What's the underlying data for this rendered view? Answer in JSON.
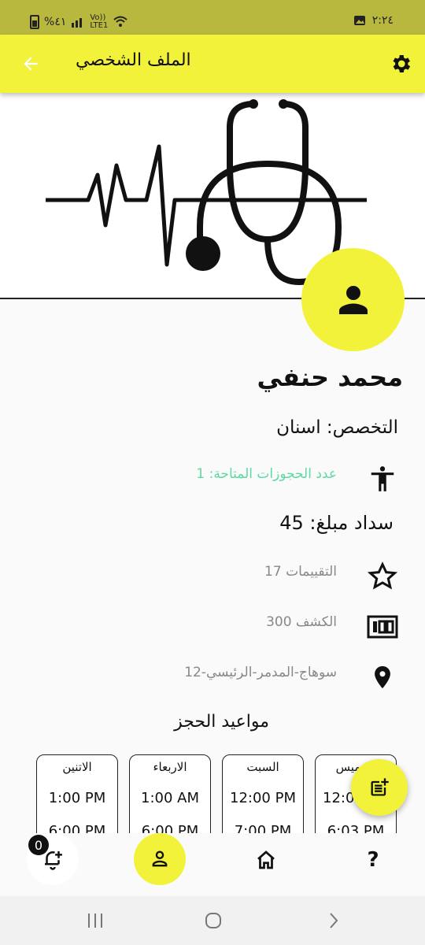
{
  "status_bar": {
    "battery_text": "%٤١",
    "network_text_top": "Vo))",
    "network_text_bottom": "LTE1",
    "time": "٢:٢٤"
  },
  "app_bar": {
    "title": "الملف الشخصي",
    "back_icon": "arrow-back-icon",
    "settings_icon": "gear-icon"
  },
  "profile": {
    "name": "محمد   حنفي",
    "specialty": "التخصص: اسنان",
    "available_bookings": "عدد الحجوزات المتاحة: 1",
    "payment": "سداد مبلغ: 45",
    "ratings": "التقييمات 17",
    "examination_fee": "الكشف 300",
    "address": "سوهاج-المدمر-الرئيسي-12"
  },
  "schedule": {
    "title": "مواعيد الحجز",
    "cards": [
      {
        "day": "الاتنين",
        "from": "1:00 PM",
        "to": "6:00 PM"
      },
      {
        "day": "الاربعاء",
        "from": "1:00 AM",
        "to": "6:00 PM"
      },
      {
        "day": "السبت",
        "from": "12:00 PM",
        "to": "7:00 PM"
      },
      {
        "day": "الخميس",
        "from": "12:00 PM",
        "to": "6:03 PM"
      }
    ]
  },
  "bottom_nav": {
    "notification_count": "0",
    "help_label": "?"
  },
  "colors": {
    "primary": "#f3f23a",
    "status_bar": "#b8b83e",
    "accent_text": "#5dd9a2"
  }
}
